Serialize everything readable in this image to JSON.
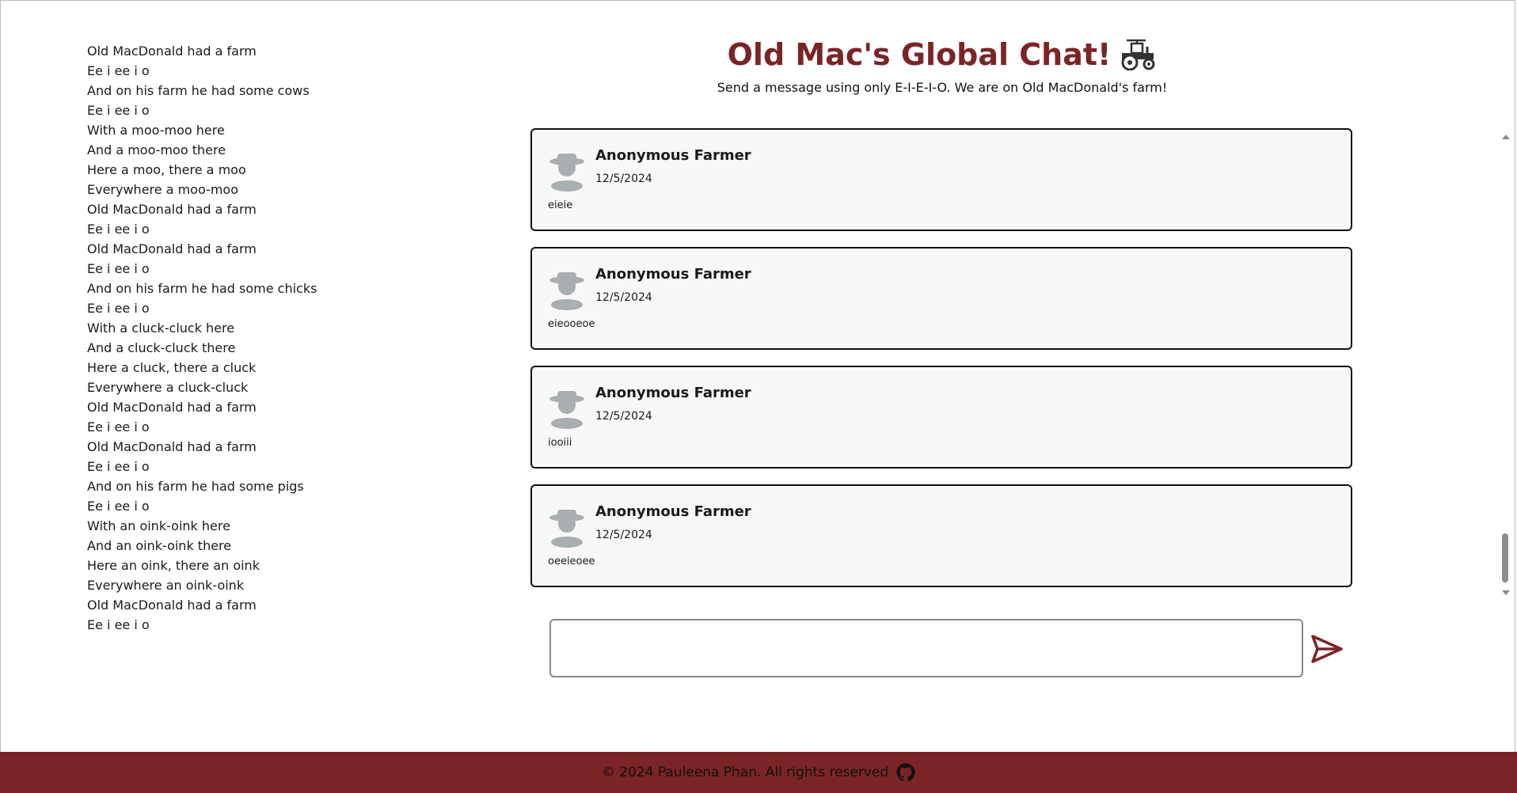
{
  "lyrics": [
    "Old MacDonald had a farm",
    "Ee i ee i o",
    "And on his farm he had some cows",
    "Ee i ee i o",
    "With a moo-moo here",
    "And a moo-moo there",
    "Here a moo, there a moo",
    "Everywhere a moo-moo",
    "Old MacDonald had a farm",
    "Ee i ee i o",
    "Old MacDonald had a farm",
    "Ee i ee i o",
    "And on his farm he had some chicks",
    "Ee i ee i o",
    "With a cluck-cluck here",
    "And a cluck-cluck there",
    "Here a cluck, there a cluck",
    "Everywhere a cluck-cluck",
    "Old MacDonald had a farm",
    "Ee i ee i o",
    "Old MacDonald had a farm",
    "Ee i ee i o",
    "And on his farm he had some pigs",
    "Ee i ee i o",
    "With an oink-oink here",
    "And an oink-oink there",
    "Here an oink, there an oink",
    "Everywhere an oink-oink",
    "Old MacDonald had a farm",
    "Ee i ee i o"
  ],
  "header": {
    "title": "Old Mac's Global Chat!",
    "title_icon": "tractor-icon",
    "subtitle": "Send a message using only E-I-E-I-O. We are on Old MacDonald's farm!"
  },
  "messages": [
    {
      "author": "Anonymous Farmer",
      "date": "12/5/2024",
      "text": "eieie"
    },
    {
      "author": "Anonymous Farmer",
      "date": "12/5/2024",
      "text": "eieooeoe"
    },
    {
      "author": "Anonymous Farmer",
      "date": "12/5/2024",
      "text": "iooiii"
    },
    {
      "author": "Anonymous Farmer",
      "date": "12/5/2024",
      "text": "oeeieoee"
    }
  ],
  "composer": {
    "value": "",
    "placeholder": "",
    "send_icon": "send-icon"
  },
  "footer": {
    "copyright": "© 2024 Pauleena Phan. All rights reserved",
    "icon": "github-icon"
  },
  "colors": {
    "brand": "#7b2426",
    "card_bg": "#f8f8f8",
    "avatar": "#a9aeb0"
  }
}
